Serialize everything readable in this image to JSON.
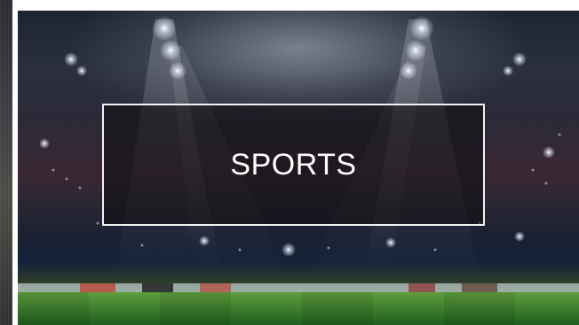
{
  "card": {
    "title": "SPORTS",
    "image": "stadium-floodlights-image"
  },
  "colors": {
    "overlay": "#0c0c0e",
    "border": "#f2f2f2",
    "text": "#ffffff",
    "pitch": "#2e7f2a",
    "sky": "#1d2432"
  }
}
